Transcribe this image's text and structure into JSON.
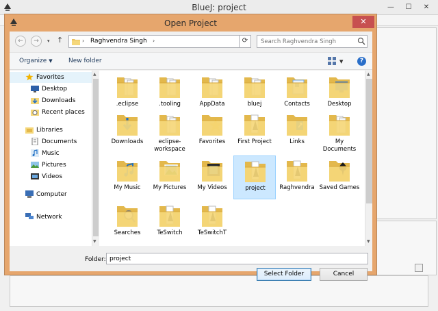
{
  "bg_window": {
    "title": "BlueJ:  project"
  },
  "dialog": {
    "title": "Open Project",
    "close_glyph": "✕",
    "address": {
      "path": "Raghvendra Singh"
    },
    "search": {
      "placeholder": "Search Raghvendra Singh"
    },
    "toolbar": {
      "organize": "Organize",
      "new_folder": "New folder",
      "help": "?"
    },
    "nav": {
      "favorites": {
        "label": "Favorites",
        "items": [
          "Desktop",
          "Downloads",
          "Recent places"
        ]
      },
      "libraries": {
        "label": "Libraries",
        "items": [
          "Documents",
          "Music",
          "Pictures",
          "Videos"
        ]
      },
      "computer": "Computer",
      "network": "Network"
    },
    "files": [
      {
        "name": ".eclipse",
        "kind": "folder-docs"
      },
      {
        "name": ".tooling",
        "kind": "folder-docs"
      },
      {
        "name": "AppData",
        "kind": "folder-docs"
      },
      {
        "name": "bluej",
        "kind": "folder-docs"
      },
      {
        "name": "Contacts",
        "kind": "folder-contacts"
      },
      {
        "name": "Desktop",
        "kind": "folder-desktop"
      },
      {
        "name": "Downloads",
        "kind": "folder-downloads"
      },
      {
        "name": "eclipse-workspace",
        "kind": "folder-docs"
      },
      {
        "name": "Favorites",
        "kind": "folder-favorites"
      },
      {
        "name": "First Project",
        "kind": "folder-bluej"
      },
      {
        "name": "Links",
        "kind": "folder-links"
      },
      {
        "name": "My Documents",
        "kind": "folder-docs"
      },
      {
        "name": "My Music",
        "kind": "folder-music"
      },
      {
        "name": "My Pictures",
        "kind": "folder-pictures"
      },
      {
        "name": "My Videos",
        "kind": "folder-videos"
      },
      {
        "name": "project",
        "kind": "folder-bluej",
        "selected": true
      },
      {
        "name": "Raghvendra",
        "kind": "folder-bluej"
      },
      {
        "name": "Saved Games",
        "kind": "folder-games"
      },
      {
        "name": "Searches",
        "kind": "folder-search"
      },
      {
        "name": "TeSwitch",
        "kind": "folder-bluej"
      },
      {
        "name": "TeSwitchT",
        "kind": "folder-bluej"
      }
    ],
    "folder_label": "Folder:",
    "folder_value": "project",
    "buttons": {
      "select": "Select Folder",
      "cancel": "Cancel"
    }
  },
  "colors": {
    "dialog_frame": "#e6a66d",
    "close_button": "#c75050",
    "selection": "#cce8ff",
    "folder": "#f5d77a"
  }
}
